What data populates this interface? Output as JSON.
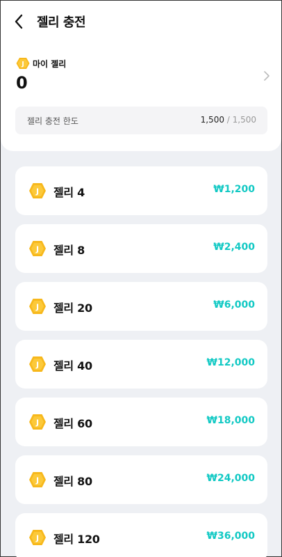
{
  "header": {
    "title": "젤리 충전"
  },
  "my_jelly": {
    "label": "마이 젤리",
    "value": "0"
  },
  "limit": {
    "label": "젤리 충전 한도",
    "current": "1,500",
    "separator": " / ",
    "max": "1,500"
  },
  "coin_color": "#f7b81c",
  "accent_color": "#12c9c4",
  "items": [
    {
      "name": "젤리 4",
      "price": "₩1,200"
    },
    {
      "name": "젤리 8",
      "price": "₩2,400"
    },
    {
      "name": "젤리 20",
      "price": "₩6,000"
    },
    {
      "name": "젤리 40",
      "price": "₩12,000"
    },
    {
      "name": "젤리 60",
      "price": "₩18,000"
    },
    {
      "name": "젤리 80",
      "price": "₩24,000"
    },
    {
      "name": "젤리 120",
      "price": "₩36,000"
    }
  ]
}
